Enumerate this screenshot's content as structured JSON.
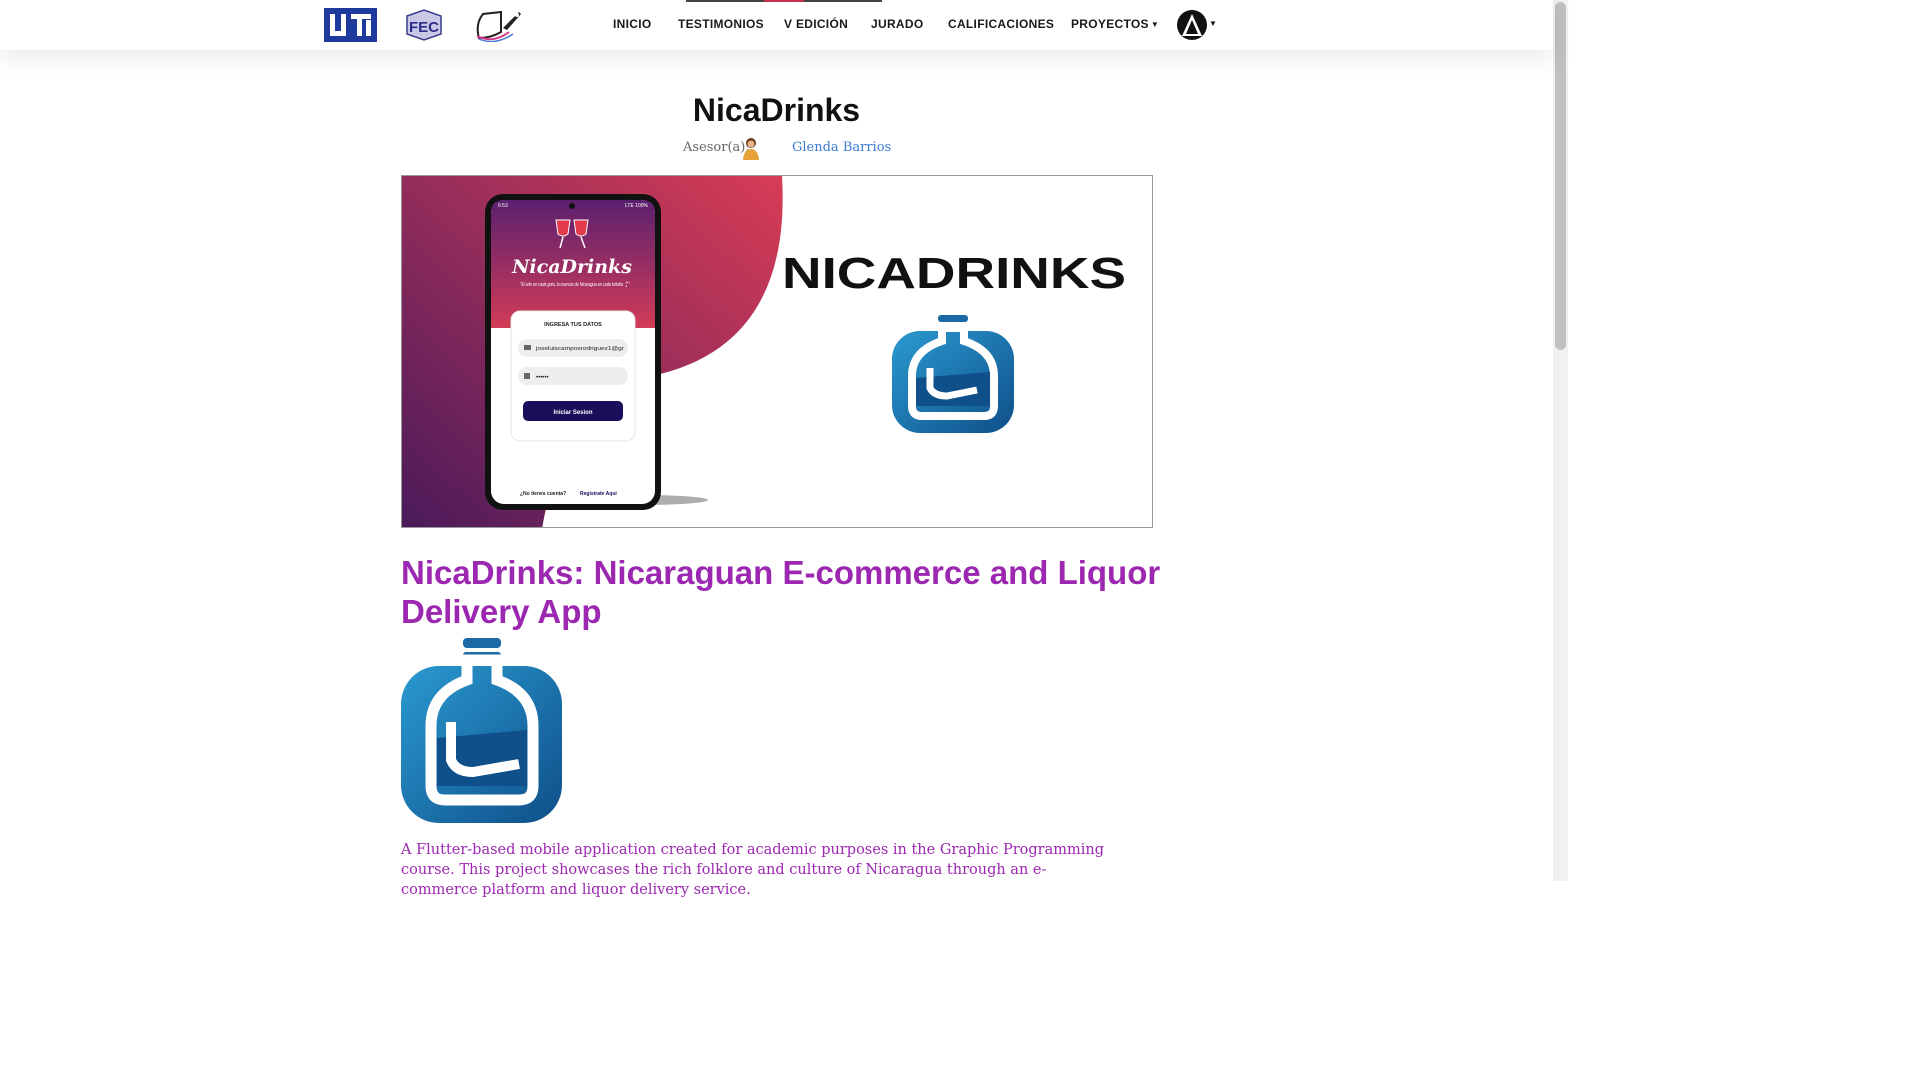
{
  "nav": {
    "items": [
      {
        "label": "INICIO"
      },
      {
        "label": "TESTIMONIOS"
      },
      {
        "label": "V EDICIÓN"
      },
      {
        "label": "JURADO"
      },
      {
        "label": "CALIFICACIONES"
      },
      {
        "label": "PROYECTOS",
        "has_dropdown": true
      }
    ],
    "logos": [
      "uni-logo",
      "fec-logo",
      "rocket-logo"
    ],
    "active_colors": [
      "#444444",
      "#c62f4b",
      "#444444"
    ]
  },
  "project": {
    "title": "NicaDrinks",
    "advisor_label": "Asesor(a):",
    "advisor_name": "Glenda Barrios"
  },
  "banner": {
    "brand": "NICADRINKS",
    "phone": {
      "status_time": "6:53",
      "status_right": "LTE 100%",
      "app_name": "NicaDrinks",
      "tagline": "\"El arte en cada gota, la esencia de Nicaragua en cada botella 🍷\"",
      "card_title": "INGRESA TUS DATOS",
      "email_value": "joseluiscamposrodriguez1@gr",
      "password_value": "••••••",
      "login_button": "Iniciar Sesion",
      "signup_prompt": "¿No tienes cuenta?",
      "signup_link": "Registrate Aqui"
    },
    "colors": {
      "gradient_start": "#5a1f5c",
      "gradient_end": "#d03a55",
      "icon_blue": "#1b6aa5"
    }
  },
  "article": {
    "title": "NicaDrinks: Nicaraguan E-commerce and Liquor Delivery App",
    "description": "A Flutter-based mobile application created for academic purposes in the Graphic Programming course. This project showcases the rich folklore and culture of Nicaragua through an e-commerce platform and liquor delivery service."
  },
  "colors": {
    "accent": "#9c27b0",
    "link": "#3a7bd5"
  }
}
